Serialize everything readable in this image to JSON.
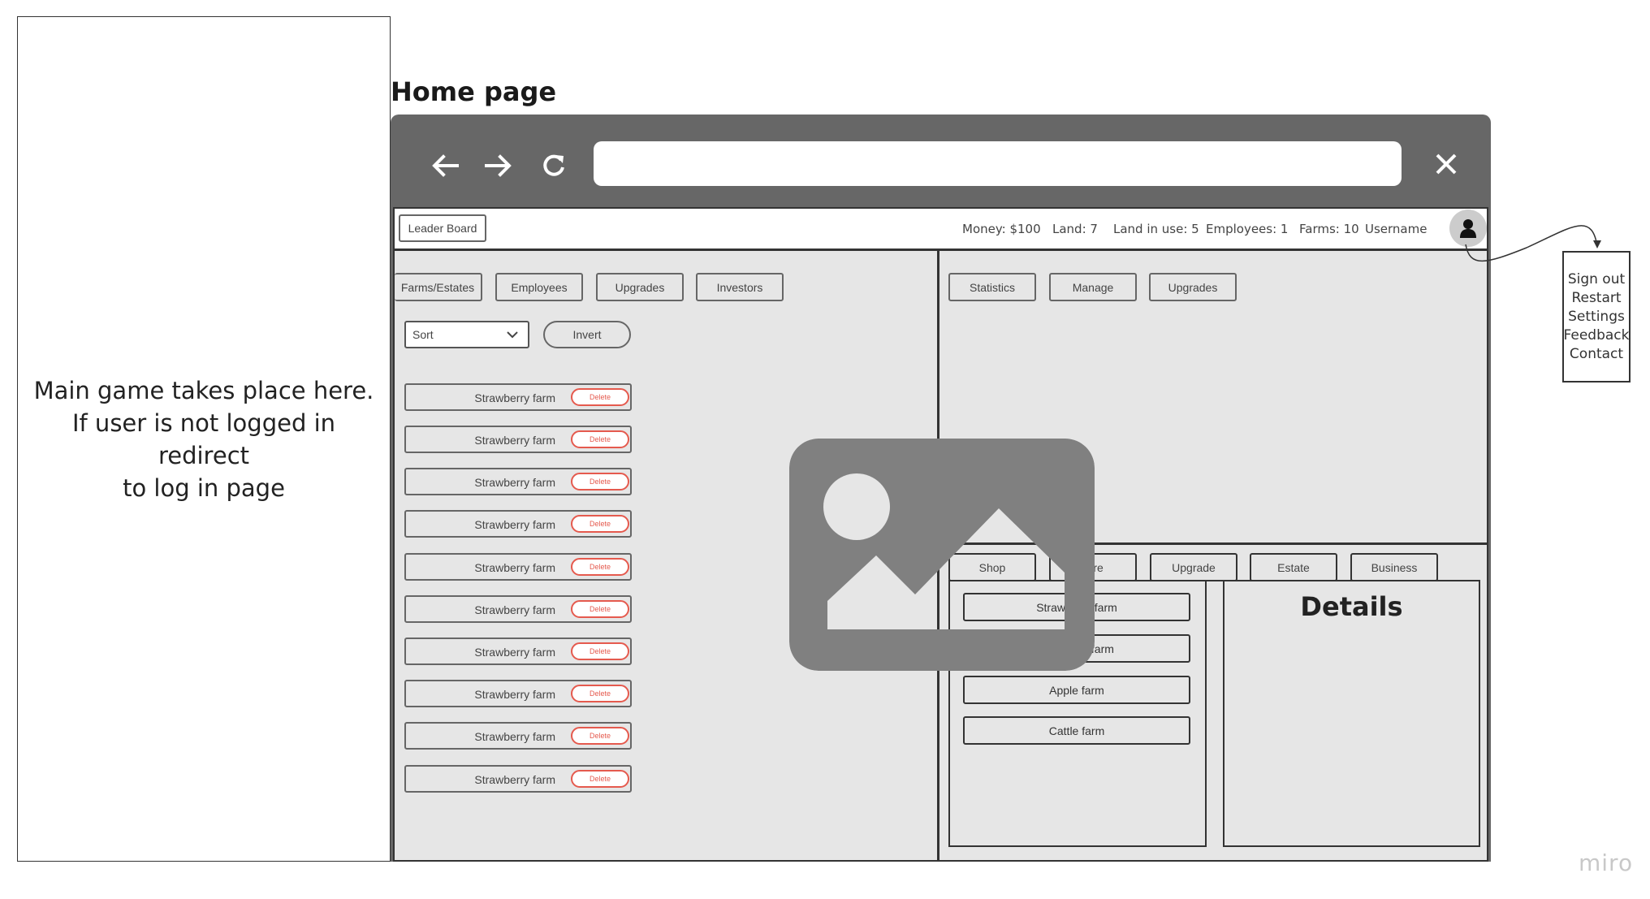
{
  "note": {
    "lines": [
      "Main game takes place here.",
      "If user is not logged in redirect",
      "to log in page"
    ]
  },
  "page_title": "Home page",
  "browser": {
    "back_icon": "arrow-left-icon",
    "forward_icon": "arrow-right-icon",
    "reload_icon": "reload-icon",
    "close_icon": "close-icon",
    "url_value": ""
  },
  "topbar": {
    "leaderboard_label": "Leader Board",
    "stats": {
      "money": "Money: $100",
      "land": "Land: 7",
      "land_in_use": "Land in use: 5",
      "employees": "Employees: 1",
      "farms": "Farms: 10",
      "username": "Username"
    },
    "avatar_icon": "user-icon"
  },
  "left_panel": {
    "tabs": [
      "Farms/Estates",
      "Employees",
      "Upgrades",
      "Investors"
    ],
    "sort": {
      "value": "Sort",
      "icon": "chevron-down-icon"
    },
    "invert_label": "Invert",
    "farms": [
      "Strawberry farm",
      "Strawberry farm",
      "Strawberry farm",
      "Strawberry farm",
      "Strawberry farm",
      "Strawberry farm",
      "Strawberry farm",
      "Strawberry farm",
      "Strawberry farm",
      "Strawberry farm"
    ],
    "delete_label": "Delete"
  },
  "right_top_panel": {
    "tabs": [
      "Statistics",
      "Manage",
      "Upgrades"
    ]
  },
  "right_bottom_panel": {
    "tabs": [
      "Shop",
      "Hire",
      "Upgrade",
      "Estate",
      "Business"
    ],
    "shop_items": [
      "Strawberry farm",
      "Blueberry farm",
      "Apple farm",
      "Cattle farm"
    ],
    "details_title": "Details"
  },
  "user_menu": {
    "items": [
      "Sign out",
      "Restart",
      "Settings",
      "Feedback",
      "Contact"
    ]
  },
  "placeholder_image_icon": "image-placeholder-icon",
  "watermark": "miro",
  "colors": {
    "browser_chrome": "#676767",
    "viewport_bg": "#e6e6e6",
    "delete_accent": "#e55a4e",
    "placeholder_gray": "#808080"
  }
}
